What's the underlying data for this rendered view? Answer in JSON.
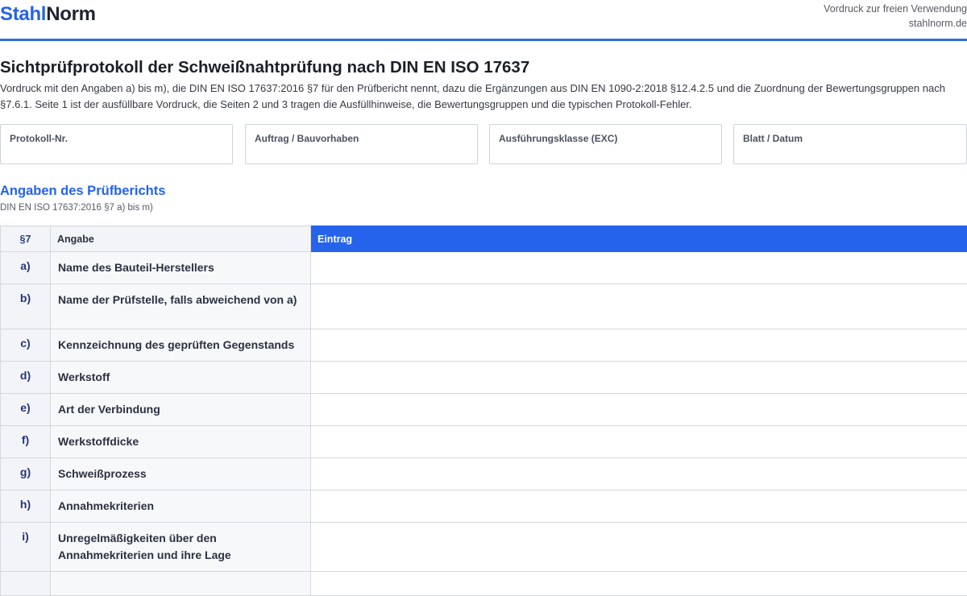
{
  "header": {
    "logo_part1": "Stahl",
    "logo_part2": "Norm",
    "note": "Vordruck zur freien Verwendung",
    "site": "stahlnorm.de"
  },
  "page": {
    "title": "Sichtprüfprotokoll der Schweißnahtprüfung nach DIN EN ISO 17637",
    "intro": "Vordruck mit den Angaben a) bis m), die DIN EN ISO 17637:2016 §7 für den Prüfbericht nennt, dazu die Ergänzungen aus DIN EN 1090-2:2018 §12.4.2.5 und die Zuordnung der Bewertungsgruppen nach §7.6.1. Seite 1 ist der ausfüllbare Vordruck, die Seiten 2 und 3 tragen die Ausfüllhinweise, die Bewertungsgruppen und die typischen Protokoll-Fehler."
  },
  "fields": [
    {
      "label": "Protokoll-Nr.",
      "value": ""
    },
    {
      "label": "Auftrag / Bauvorhaben",
      "value": ""
    },
    {
      "label": "Ausführungsklasse (EXC)",
      "value": ""
    },
    {
      "label": "Blatt / Datum",
      "value": ""
    }
  ],
  "section": {
    "title": "Angaben des Prüfberichts",
    "subtitle": "DIN EN ISO 17637:2016 §7 a) bis m)"
  },
  "table": {
    "headers": [
      "§7",
      "Angabe",
      "Eintrag"
    ],
    "rows": [
      {
        "key": "a)",
        "label": "Name des Bauteil-Herstellers",
        "entry": ""
      },
      {
        "key": "b)",
        "label": "Name der Prüfstelle, falls abweichend von a)",
        "entry": ""
      },
      {
        "key": "c)",
        "label": "Kennzeichnung des geprüften Gegenstands",
        "entry": ""
      },
      {
        "key": "d)",
        "label": "Werkstoff",
        "entry": ""
      },
      {
        "key": "e)",
        "label": "Art der Verbindung",
        "entry": ""
      },
      {
        "key": "f)",
        "label": "Werkstoffdicke",
        "entry": ""
      },
      {
        "key": "g)",
        "label": "Schweißprozess",
        "entry": ""
      },
      {
        "key": "h)",
        "label": "Annahmekriterien",
        "entry": ""
      },
      {
        "key": "i)",
        "label": "Unregelmäßigkeiten über den Annahmekriterien und ihre Lage",
        "entry": ""
      },
      {
        "key": "",
        "label": "",
        "entry": ""
      }
    ]
  }
}
